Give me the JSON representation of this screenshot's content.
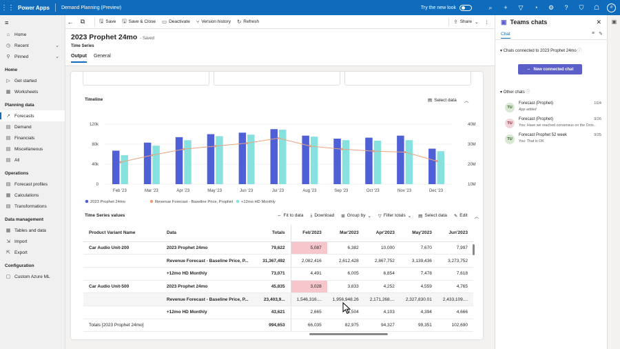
{
  "topbar": {
    "app_name": "Power Apps",
    "environment": "Demand Planning (Preview)",
    "try_new_look": "Try the new look",
    "avatar": "#"
  },
  "nav": {
    "items_top": [
      {
        "label": "Home",
        "icon": "home-icon"
      },
      {
        "label": "Recent",
        "icon": "clock-icon",
        "chevron": true
      },
      {
        "label": "Pinned",
        "icon": "pin-icon",
        "chevron": true
      }
    ],
    "groups": [
      {
        "title": "Home",
        "items": [
          {
            "label": "Get started"
          },
          {
            "label": "Worksheets"
          }
        ]
      },
      {
        "title": "Planning data",
        "items": [
          {
            "label": "Forecasts",
            "active": true
          },
          {
            "label": "Demand"
          },
          {
            "label": "Financials"
          },
          {
            "label": "Miscellaneous"
          },
          {
            "label": "All"
          }
        ]
      },
      {
        "title": "Operations",
        "items": [
          {
            "label": "Forecast profiles"
          },
          {
            "label": "Calculations"
          },
          {
            "label": "Transformations"
          }
        ]
      },
      {
        "title": "Data management",
        "items": [
          {
            "label": "Tables and data"
          },
          {
            "label": "Import"
          },
          {
            "label": "Export"
          }
        ]
      },
      {
        "title": "Configuration",
        "items": [
          {
            "label": "Custom Azure ML"
          }
        ]
      }
    ]
  },
  "commands": {
    "save": "Save",
    "save_close": "Save & Close",
    "deactivate": "Deactivate",
    "version_history": "Version history",
    "refresh": "Refresh",
    "share": "Share"
  },
  "record": {
    "title": "2023 Prophet 24mo",
    "saved": "- Saved",
    "subtitle": "Time Series",
    "tabs": [
      "Output",
      "General"
    ]
  },
  "timeline": {
    "title": "Timeline",
    "select_data": "Select data"
  },
  "chart_data": {
    "type": "bar",
    "categories": [
      "Feb '23",
      "Mar '23",
      "Apr '23",
      "May '23",
      "Jun '23",
      "Jul '23",
      "Aug '23",
      "Sep '23",
      "Oct '23",
      "Nov '23",
      "Dec '23"
    ],
    "series": [
      {
        "name": "2023 Prophet 24mo",
        "type": "bar",
        "axis": "left",
        "color": "#4f60d6",
        "values": [
          67,
          83,
          94,
          100,
          103,
          110,
          97,
          91,
          93,
          97,
          71
        ]
      },
      {
        "name": "+12mo HD Monthly",
        "type": "bar",
        "axis": "left",
        "color": "#87e2df",
        "values": [
          58,
          77,
          88,
          96,
          99,
          109,
          95,
          88,
          87,
          88,
          66
        ]
      },
      {
        "name": "Revenue Forecast - Baseline Price, Prophet",
        "type": "line",
        "axis": "right",
        "color": "#e8a27c",
        "values": [
          21.0,
          24.5,
          27.5,
          29.0,
          30.5,
          33.0,
          29.0,
          27.5,
          26.5,
          26.0,
          21.5
        ]
      }
    ],
    "y_left": {
      "ticks": [
        "0",
        "40k",
        "80k",
        "120k"
      ],
      "range": [
        0,
        120
      ]
    },
    "y_right": {
      "ticks": [
        "10M",
        "20M",
        "30M",
        "40M"
      ],
      "range": [
        10,
        40
      ]
    },
    "legend": "bottom-left"
  },
  "table": {
    "title": "Time Series values",
    "actions": [
      "Fit to data",
      "Download",
      "Group by",
      "Filter totals",
      "Select data",
      "Edit"
    ],
    "columns": [
      "Product Variant Name",
      "Data",
      "Totals",
      "Feb'2023",
      "Mar'2023",
      "Apr'2023",
      "May'2023",
      "Jun'2023"
    ],
    "rows": [
      {
        "product": "Car Audio Unit-200",
        "data": "2023 Prophet 24mo",
        "totals": "79,622",
        "vals": [
          "5,087",
          "6,382",
          "10,000",
          "7,670",
          "7,997"
        ],
        "pink": true
      },
      {
        "product": "",
        "data": "Revenue Forecast - Baseline Price, P...",
        "totals": "31,367,492",
        "vals": [
          "2,082,416",
          "2,612,428",
          "2,867,752",
          "3,139,436",
          "3,273,752"
        ]
      },
      {
        "product": "",
        "data": "+12mo HD Monthly",
        "totals": "73,071",
        "vals": [
          "4,491",
          "6,005",
          "6,854",
          "7,478",
          "7,618"
        ]
      },
      {
        "product": "Car Audio Unit-500",
        "data": "2023 Prophet 24mo",
        "totals": "45,835",
        "vals": [
          "3,028",
          "3,833",
          "4,252",
          "4,559",
          "4,765"
        ],
        "pink": true
      },
      {
        "product": "",
        "data": "Revenue Forecast - Baseline Price, P...",
        "totals": "23,403,9...",
        "vals": [
          "1,546,316....",
          "1,956,948.26",
          "2,171,268....",
          "2,327,830.01",
          "2,433,109...."
        ],
        "highlight": true
      },
      {
        "product": "",
        "data": "+12mo HD Monthly",
        "totals": "43,621",
        "vals": [
          "2,665",
          "3,504",
          "4,103",
          "4,394",
          "4,666"
        ]
      },
      {
        "product": "Totals [2023 Prophet 24mo]",
        "data": "",
        "totals": "994,653",
        "vals": [
          "66,035",
          "82,975",
          "94,327",
          "99,351",
          "102,690"
        ],
        "totalrow": true
      }
    ]
  },
  "teams": {
    "title": "Teams chats",
    "tab": "Chat",
    "connected_header": "Chats connected to 2023 Prophet 24mo",
    "new_chat": "New connected chat",
    "other_header": "Other chats",
    "chats": [
      {
        "initials": "TU",
        "name": "Forecast (Prophet)",
        "msg": "App added",
        "date": "10/4",
        "italic": true
      },
      {
        "initials": "TU",
        "name": "Forecast (Prophet)",
        "msg": "You: Have we reached consensus on the Octo...",
        "date": "9/26",
        "pink": true
      },
      {
        "initials": "TU",
        "name": "Forecast Prophet 52 week",
        "msg": "You: That is OK",
        "date": "9/25"
      }
    ]
  }
}
